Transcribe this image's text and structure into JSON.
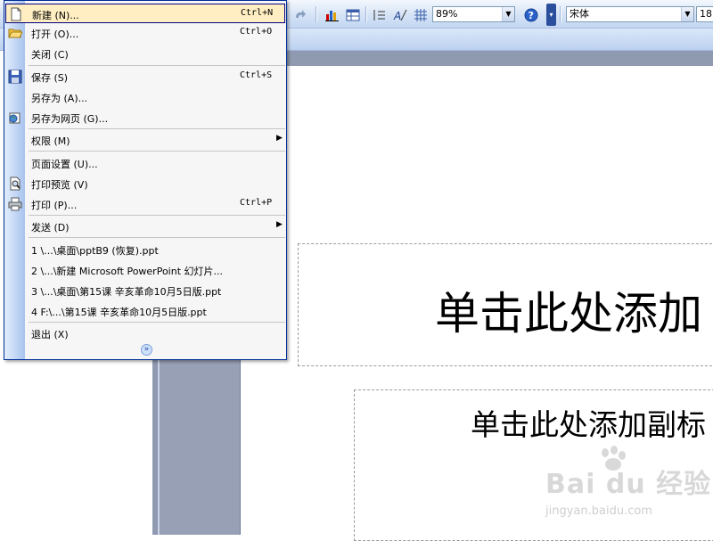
{
  "toolbar": {
    "zoom": "89%",
    "font_name": "宋体",
    "font_size": "18"
  },
  "menu": {
    "items": [
      {
        "label": "新建 (N)...",
        "shortcut": "Ctrl+N"
      },
      {
        "label": "打开 (O)...",
        "shortcut": "Ctrl+O"
      },
      {
        "label": "关闭 (C)",
        "shortcut": ""
      },
      {
        "label": "保存 (S)",
        "shortcut": "Ctrl+S"
      },
      {
        "label": "另存为 (A)...",
        "shortcut": ""
      },
      {
        "label": "另存为网页 (G)...",
        "shortcut": ""
      },
      {
        "label": "权限 (M)",
        "shortcut": ""
      },
      {
        "label": "页面设置 (U)...",
        "shortcut": ""
      },
      {
        "label": "打印预览 (V)",
        "shortcut": ""
      },
      {
        "label": "打印 (P)...",
        "shortcut": "Ctrl+P"
      },
      {
        "label": "发送 (D)",
        "shortcut": ""
      }
    ],
    "recent": [
      "1 \\...\\桌面\\pptB9 (恢复).ppt",
      "2 \\...\\新建 Microsoft PowerPoint 幻灯片...",
      "3 \\...\\桌面\\第15课 辛亥革命10月5日版.ppt",
      "4 F:\\...\\第15课 辛亥革命10月5日版.ppt"
    ],
    "exit": "退出 (X)"
  },
  "slide": {
    "title_placeholder": "单击此处添加",
    "subtitle_placeholder": "单击此处添加副标"
  },
  "watermark": {
    "main": "Bai du 经验",
    "sub": "jingyan.baidu.com"
  }
}
